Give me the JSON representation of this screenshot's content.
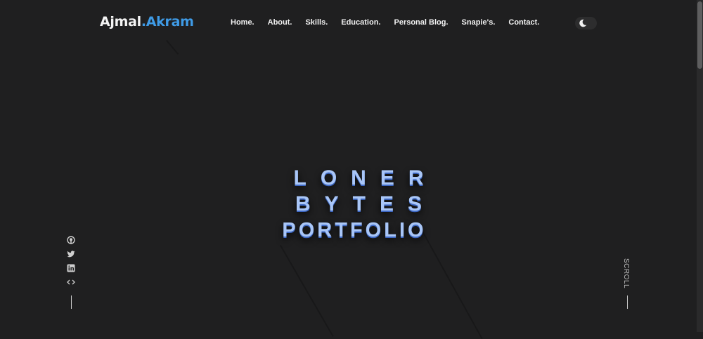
{
  "header": {
    "logo_first": "Ajmal",
    "logo_second": ".Akram",
    "nav": [
      "Home.",
      "About.",
      "Skills.",
      "Education.",
      "Personal Blog.",
      "Snapie's.",
      "Contact."
    ],
    "theme_toggle_icon": "moon-icon"
  },
  "hero": {
    "line1": "LONER",
    "line2": "BYTES",
    "line3": "PORTFOLIO"
  },
  "social": [
    {
      "name": "github",
      "icon": "github-icon"
    },
    {
      "name": "twitter",
      "icon": "twitter-icon"
    },
    {
      "name": "linkedin",
      "icon": "linkedin-icon"
    },
    {
      "name": "code",
      "icon": "code-icon"
    }
  ],
  "scroll_label": "SCROLL",
  "colors": {
    "background": "#1f1f20",
    "accent": "#3f9be6",
    "hero_text": "#a9c6f7",
    "hero_shadow": "#3d67c2"
  }
}
